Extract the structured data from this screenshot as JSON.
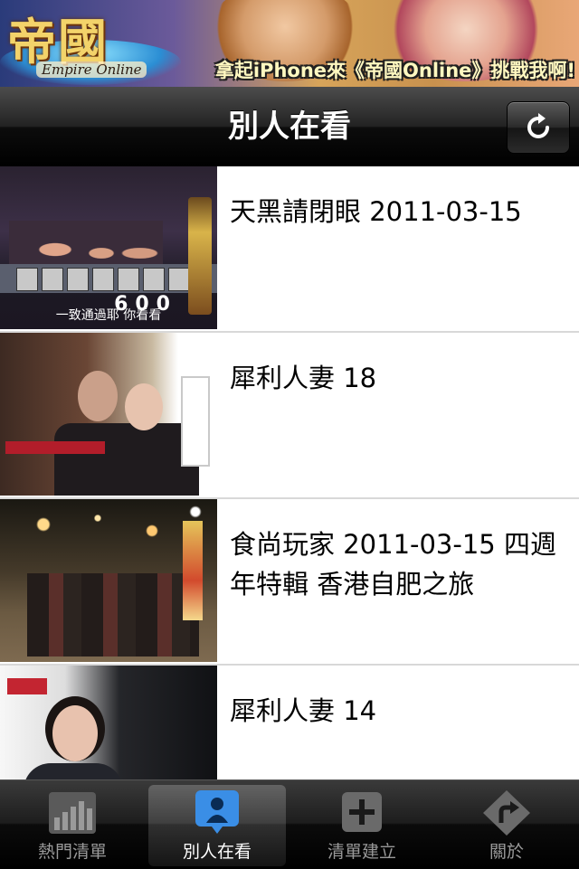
{
  "ad": {
    "logo_text": "帝國",
    "logo_sub": "Empire Online",
    "caption": "拿起iPhone來《帝國Online》挑戰我啊!"
  },
  "navbar": {
    "title": "別人在看",
    "refresh_icon": "refresh-icon"
  },
  "list": {
    "items": [
      {
        "title": "天黑請閉眼 2011-03-15",
        "thumb": {
          "score": "600",
          "subtitle": "一致通過耶 你看看"
        }
      },
      {
        "title": "犀利人妻 18"
      },
      {
        "title": "食尚玩家 2011-03-15 四週年特輯 香港自肥之旅"
      },
      {
        "title": "犀利人妻 14"
      }
    ]
  },
  "tabbar": {
    "tabs": [
      {
        "label": "熱門清單",
        "icon": "bar-chart-icon",
        "selected": false
      },
      {
        "label": "別人在看",
        "icon": "person-icon",
        "selected": true
      },
      {
        "label": "清單建立",
        "icon": "plus-icon",
        "selected": false
      },
      {
        "label": "關於",
        "icon": "turn-arrow-icon",
        "selected": false
      }
    ]
  },
  "colors": {
    "tab_selected_blue": "#3a8ee6",
    "tab_inactive": "#999999"
  }
}
